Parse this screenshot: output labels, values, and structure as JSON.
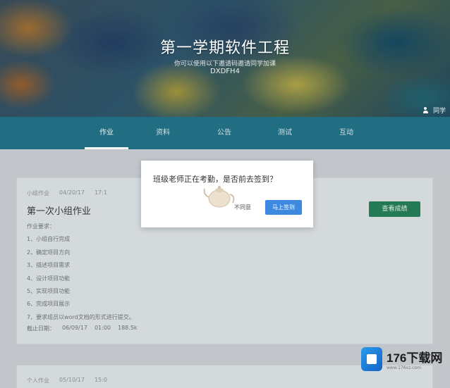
{
  "hero": {
    "title": "第一学期软件工程",
    "subtitle": "你可以使用以下邀请码邀请同学加课",
    "code": "DXDFH4",
    "members_label": "同学"
  },
  "nav": {
    "items": [
      {
        "label": "作业",
        "active": true
      },
      {
        "label": "资料",
        "active": false
      },
      {
        "label": "公告",
        "active": false
      },
      {
        "label": "测试",
        "active": false
      },
      {
        "label": "互动",
        "active": false
      }
    ]
  },
  "assignment": {
    "meta": [
      "小组作业",
      "04/20/17",
      "17:1"
    ],
    "title": "第一次小组作业",
    "requirements_heading": "作业要求：",
    "requirements": [
      "1、小组自行完成",
      "2、确定项目方向",
      "3、描述项目需求",
      "4、设计项目功能",
      "5、实现项目功能",
      "6、完成项目展示",
      "7、要求组员以word文档的形式进行提交。"
    ],
    "deadline": [
      "截止日期：",
      "06/09/17",
      "01:00",
      "188.5k"
    ],
    "view_button": "查看成绩"
  },
  "assignment2": {
    "meta": [
      "个人作业",
      "05/10/17",
      "15:0"
    ]
  },
  "modal": {
    "message": "班级老师正在考勤，是否前去签到？",
    "cancel": "不同意",
    "confirm": "马上签到"
  },
  "watermark": {
    "name": "176下载网",
    "url": "www.176xz.com"
  },
  "colors": {
    "nav_bg": "#1b6c80",
    "confirm_button": "#3d89e0",
    "view_button": "#1f7a52"
  }
}
